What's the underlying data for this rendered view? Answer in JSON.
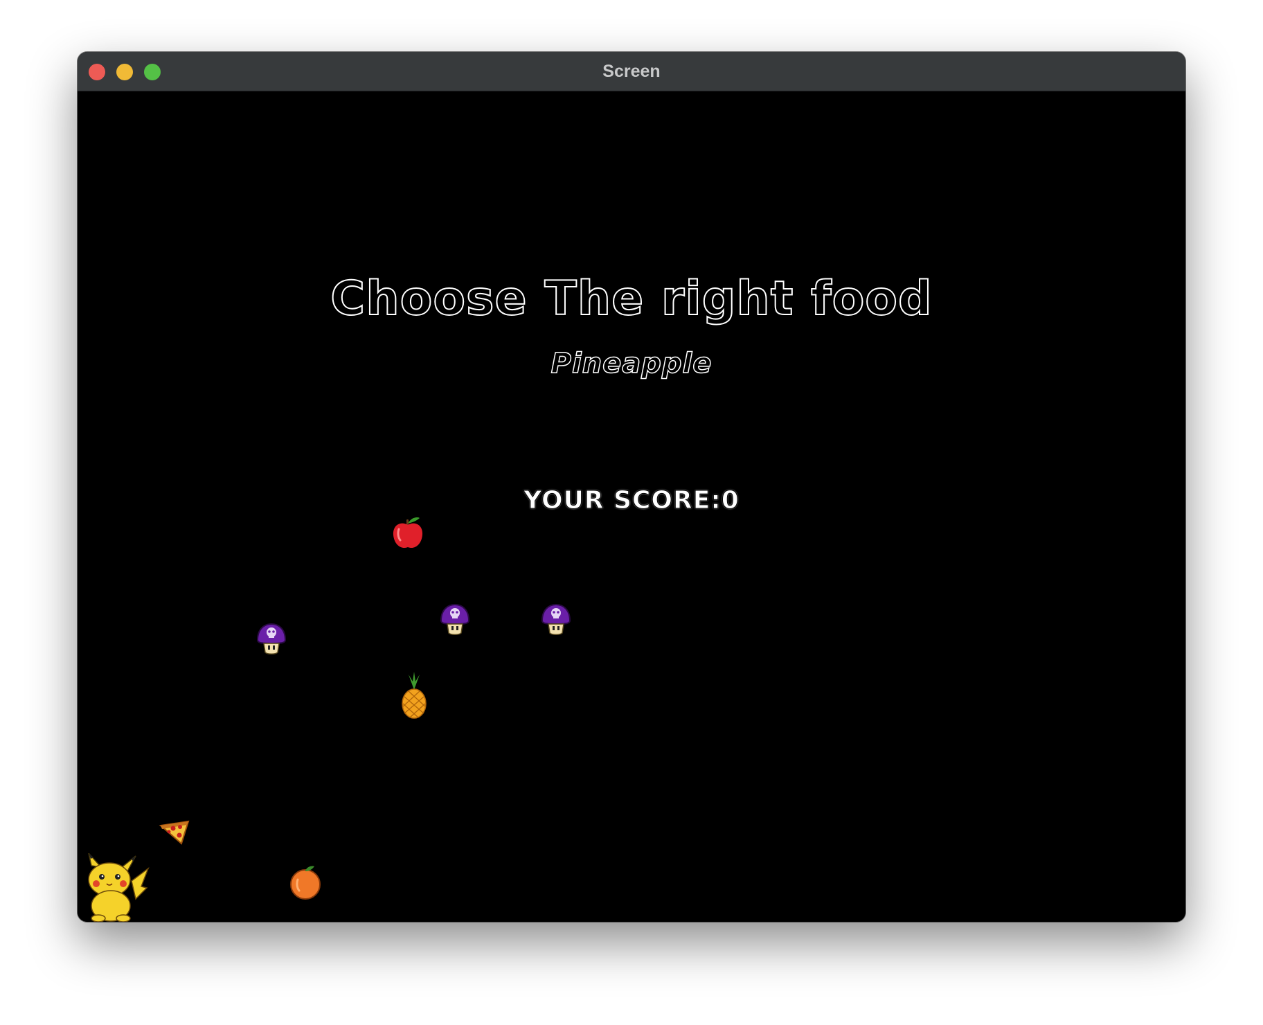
{
  "window": {
    "title": "Screen"
  },
  "game": {
    "headline": "Choose The right food",
    "target_food": "Pineapple",
    "score_text": "YOUR SCORE:0"
  },
  "sprites": {
    "player": "pikachu-character",
    "items": [
      "apple",
      "poison-mushroom",
      "poison-mushroom",
      "poison-mushroom",
      "pineapple",
      "pizza",
      "orange"
    ]
  },
  "colors": {
    "background": "#000000",
    "titlebar": "#373a3c",
    "text_outline": "#ffffff"
  }
}
